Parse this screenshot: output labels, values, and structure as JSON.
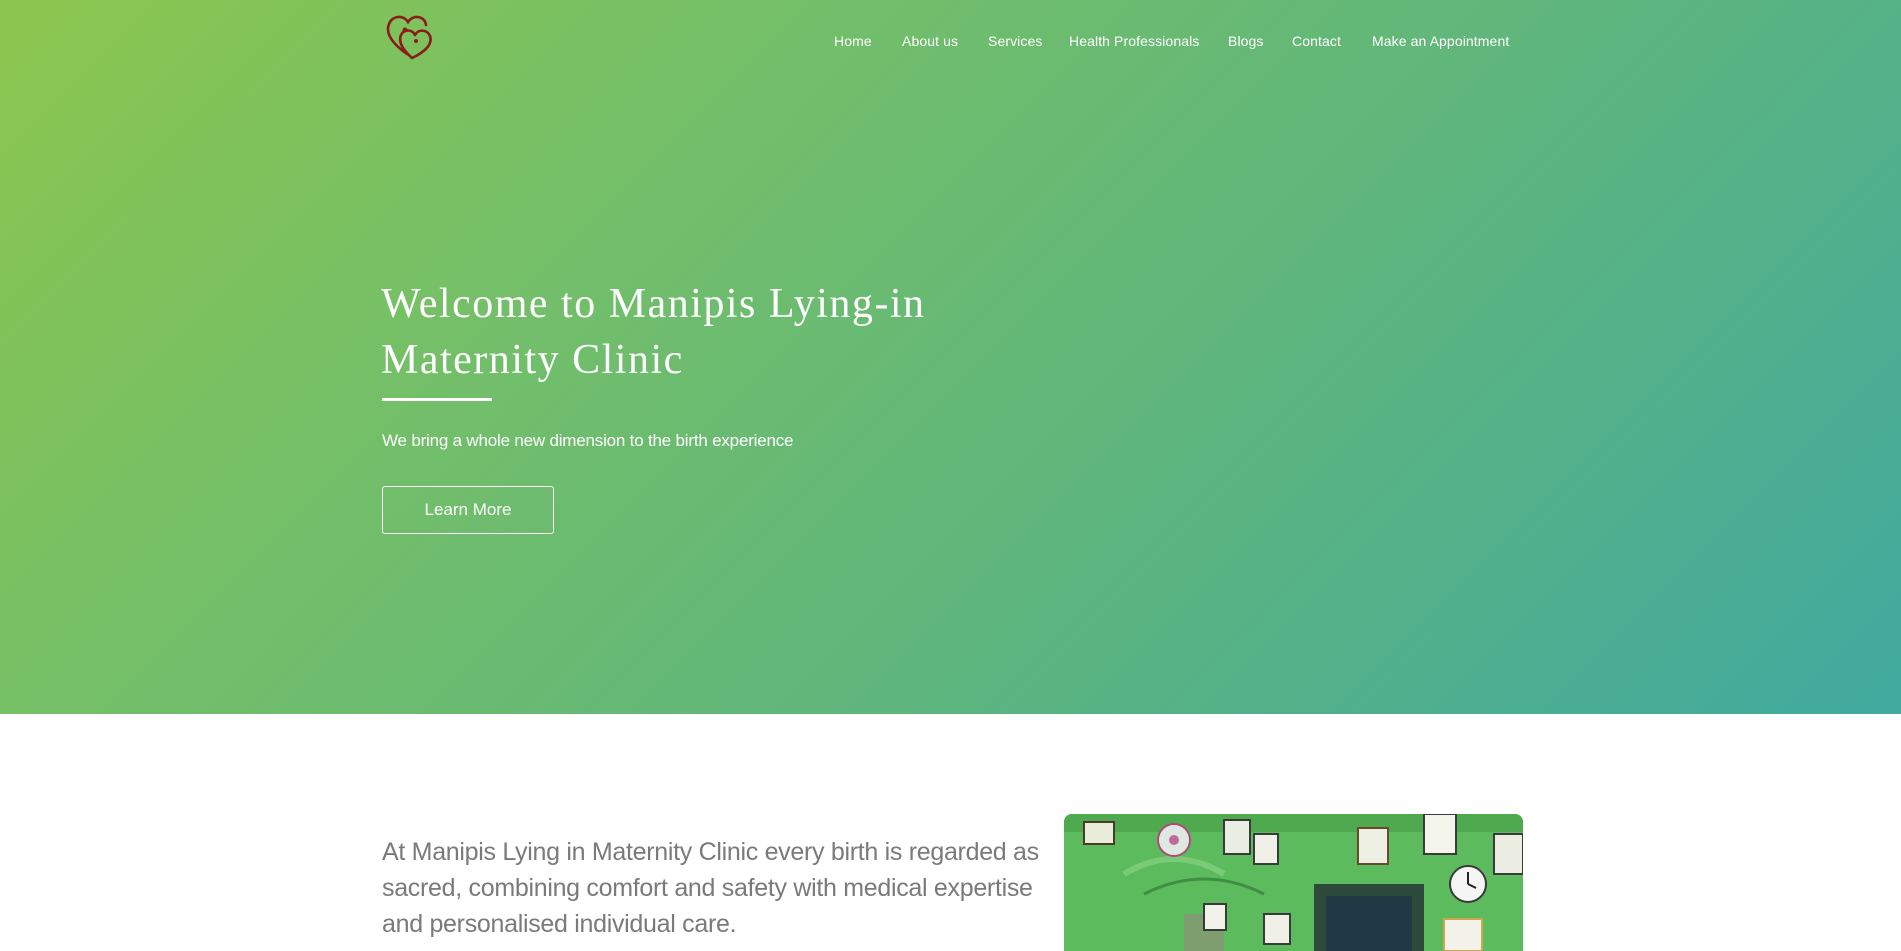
{
  "header": {
    "logo_icon": "hearts-logo-icon",
    "logo_color": "#8b1a1a"
  },
  "nav": {
    "items": [
      {
        "label": "Home"
      },
      {
        "label": "About us"
      },
      {
        "label": "Services"
      },
      {
        "label": "Health Professionals"
      },
      {
        "label": "Blogs"
      },
      {
        "label": "Contact"
      },
      {
        "label": "Make an Appointment"
      }
    ]
  },
  "hero": {
    "title": "Welcome to Manipis Lying-in Maternity Clinic",
    "subtitle": "We bring a whole new dimension to the birth experience",
    "button_label": "Learn More",
    "gradient_start": "#8cc64e",
    "gradient_end": "#41a99f"
  },
  "about": {
    "text": "At Manipis Lying in Maternity Clinic every birth is regarded as sacred, combining comfort and safety with medical expertise and personalised individual care."
  },
  "colors": {
    "text_white": "#ffffff",
    "body_text": "#7a7a7a",
    "photo_wall": "#58b85a"
  }
}
